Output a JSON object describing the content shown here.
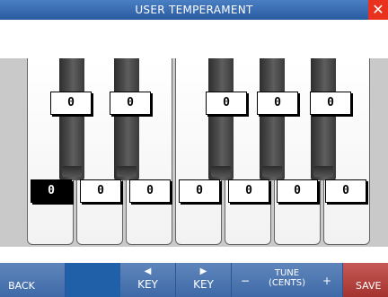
{
  "window": {
    "title": "USER TEMPERAMENT",
    "close_icon": "close-icon"
  },
  "keyboard": {
    "black_key_values": [
      "0",
      "0",
      "0",
      "0",
      "0"
    ],
    "white_key_values": [
      "0",
      "0",
      "0",
      "0",
      "0",
      "0",
      "0"
    ],
    "selected_white_key": 0
  },
  "footer": {
    "back_label": "BACK",
    "key_prev_arrow": "◀",
    "key_prev_label": "KEY",
    "key_next_arrow": "▶",
    "key_next_label": "KEY",
    "tune_minus": "−",
    "tune_label_top": "TUNE",
    "tune_label_bottom": "(CENTS)",
    "tune_plus": "+",
    "save_label": "SAVE"
  }
}
